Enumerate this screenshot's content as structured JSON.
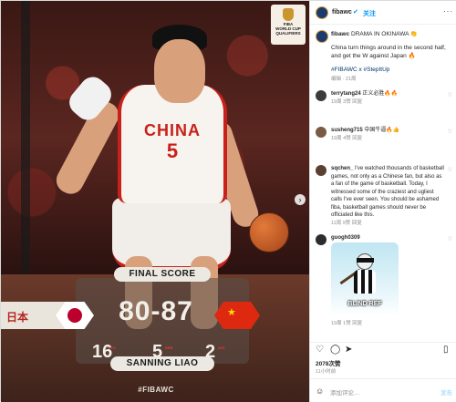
{
  "post": {
    "image": {
      "jersey_text": "CHINA",
      "jersey_number": "5",
      "banner_text": "日本",
      "event_logo": [
        "FIBA",
        "WORLD CUP",
        "QUALIFIERS"
      ],
      "final_score_label": "FINAL SCORE",
      "score": "80-87",
      "team_left_flag": "japan-flag",
      "team_right_flag": "china-flag",
      "stats": [
        {
          "value": "16",
          "label": "PTS"
        },
        {
          "value": "5",
          "label": "REB"
        },
        {
          "value": "2",
          "label": "AST"
        }
      ],
      "player_name": "SANNING LIAO",
      "hashtag": "#FIBAWC"
    }
  },
  "sidebar": {
    "account": "fibawc",
    "verified": true,
    "follow_label": "关注",
    "more_label": "···",
    "caption": {
      "user": "fibawc",
      "headline": "DRAMA IN OKINAWA 👏",
      "body": "China turn things around in the second half, and get the W against Japan 🔥",
      "tags": "#FIBAWC x #StepItUp",
      "meta": "编辑 · 21周"
    },
    "comments": [
      {
        "user": "terrytang24",
        "text": "正义必胜🔥🔥",
        "meta": "19周  3赞  回复",
        "avatar_color": "#3b3b3b"
      },
      {
        "user": "susheng715",
        "text": "中国牛逼🔥👍",
        "meta": "19周  4赞  回复",
        "avatar_color": "#7a5a44"
      },
      {
        "user": "sqchen_",
        "text": "I've watched thousands of basketball games, not only as a Chinese fan, but also as a fan of the game of basketball. Today, I witnessed some of the craziest and ugliest calls I've ever seen. You should be ashamed fiba, basketball games should never be officiated like this.",
        "meta": "11周  9赞  回复",
        "avatar_color": "#5a4032"
      },
      {
        "user": "guogh0309",
        "text": "",
        "meta": "19周  1赞  回复",
        "avatar_color": "#2c2c2c",
        "sticker_label": "BLIND REF"
      }
    ],
    "likes": "2078次赞",
    "date": "11小时前",
    "add_comment_placeholder": "添加评论…",
    "post_label": "发布",
    "icons": [
      "heart-icon",
      "comment-icon",
      "share-icon",
      "bookmark-icon"
    ]
  }
}
